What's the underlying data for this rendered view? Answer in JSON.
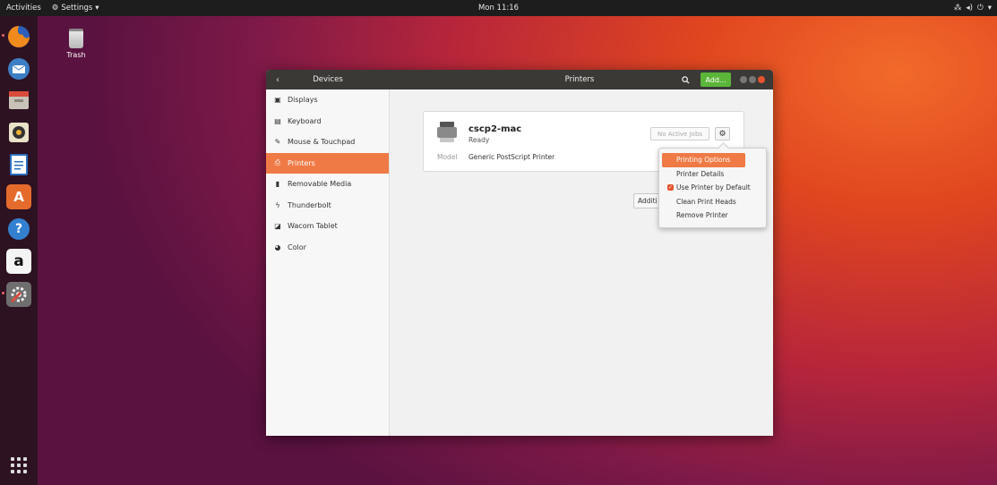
{
  "topbar": {
    "activities": "Activities",
    "app_menu": "Settings",
    "clock": "Mon 11:16"
  },
  "desktop": {
    "trash_label": "Trash"
  },
  "dock": {
    "items": [
      {
        "name": "firefox",
        "color": "#e66b1f"
      },
      {
        "name": "thunderbird",
        "color": "#3d7fc4"
      },
      {
        "name": "files",
        "color": "#c8c2b8"
      },
      {
        "name": "rhythmbox",
        "color": "#e8e2c8"
      },
      {
        "name": "libreoffice-writer",
        "color": "#2a6fbf"
      },
      {
        "name": "software-center",
        "color": "#e56b2c"
      },
      {
        "name": "help",
        "color": "#3380d0"
      },
      {
        "name": "amazon",
        "color": "#f4f4f4"
      },
      {
        "name": "settings",
        "color": "#7a7a7a"
      }
    ],
    "amazon_letter": "a",
    "help_glyph": "?",
    "software_glyph": "A"
  },
  "window": {
    "left_title": "Devices",
    "center_title": "Printers",
    "add_label": "Add...",
    "sidebar": [
      {
        "label": "Displays",
        "icon": "display-icon",
        "glyph": "▣"
      },
      {
        "label": "Keyboard",
        "icon": "keyboard-icon",
        "glyph": "▤"
      },
      {
        "label": "Mouse & Touchpad",
        "icon": "mouse-icon",
        "glyph": "✎"
      },
      {
        "label": "Printers",
        "icon": "printer-icon",
        "glyph": "⎙",
        "active": true
      },
      {
        "label": "Removable Media",
        "icon": "usb-icon",
        "glyph": "▮"
      },
      {
        "label": "Thunderbolt",
        "icon": "thunderbolt-icon",
        "glyph": "ϟ"
      },
      {
        "label": "Wacom Tablet",
        "icon": "tablet-icon",
        "glyph": "◪"
      },
      {
        "label": "Color",
        "icon": "color-icon",
        "glyph": "◕"
      }
    ]
  },
  "printer": {
    "name": "cscp2-mac",
    "status": "Ready",
    "model_label": "Model",
    "model_value": "Generic PostScript Printer",
    "jobs_label": "No Active Jobs",
    "additional_label": "Additi"
  },
  "popover": {
    "items": [
      {
        "label": "Printing Options",
        "highlighted": true
      },
      {
        "label": "Printer Details"
      },
      {
        "label": "Use Printer by Default",
        "checked": true
      },
      {
        "label": "Clean Print Heads"
      },
      {
        "label": "Remove Printer"
      }
    ]
  },
  "colors": {
    "accent": "#f07a46",
    "add_button": "#5ab538",
    "titlebar": "#3a3936"
  }
}
